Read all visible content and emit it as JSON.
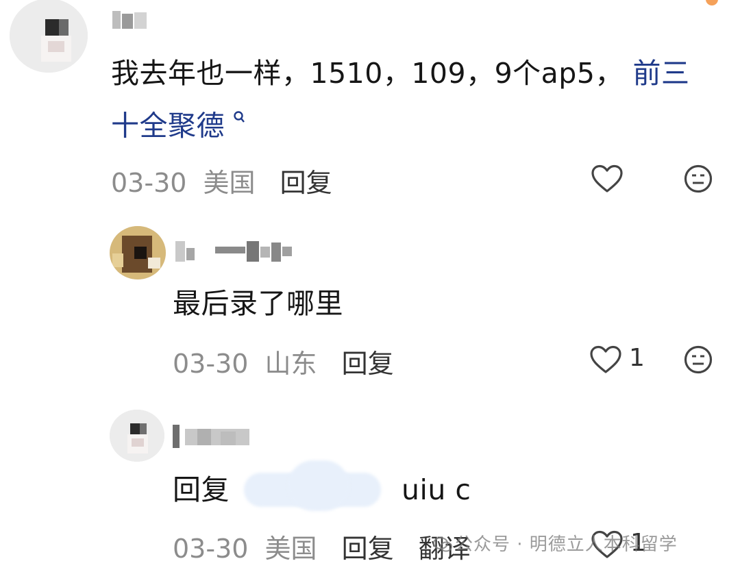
{
  "comments": [
    {
      "content_plain": "我去年也一样，1510，109，9个ap5，",
      "content_link": "前三十全聚德",
      "date": "03-30",
      "location": "美国",
      "reply_label": "回复"
    },
    {
      "content_plain": "最后录了哪里",
      "date": "03-30",
      "location": "山东",
      "reply_label": "回复",
      "like_count": "1"
    },
    {
      "reply_prefix": "回复",
      "reply_suffix": "uiu c",
      "date": "03-30",
      "location": "美国",
      "reply_label": "回复",
      "translate_label": "翻译",
      "like_count": "1"
    }
  ],
  "watermark": {
    "text": "公众号 · 明德立人本科留学"
  },
  "icons": {
    "like": "heart-icon",
    "dislike": "meh-face-icon",
    "search": "search-icon",
    "watermark_logo": "wechat-logo-icon"
  },
  "colors": {
    "link": "#1f3a8a",
    "meta": "#8c8c8c",
    "icon": "#444444"
  }
}
